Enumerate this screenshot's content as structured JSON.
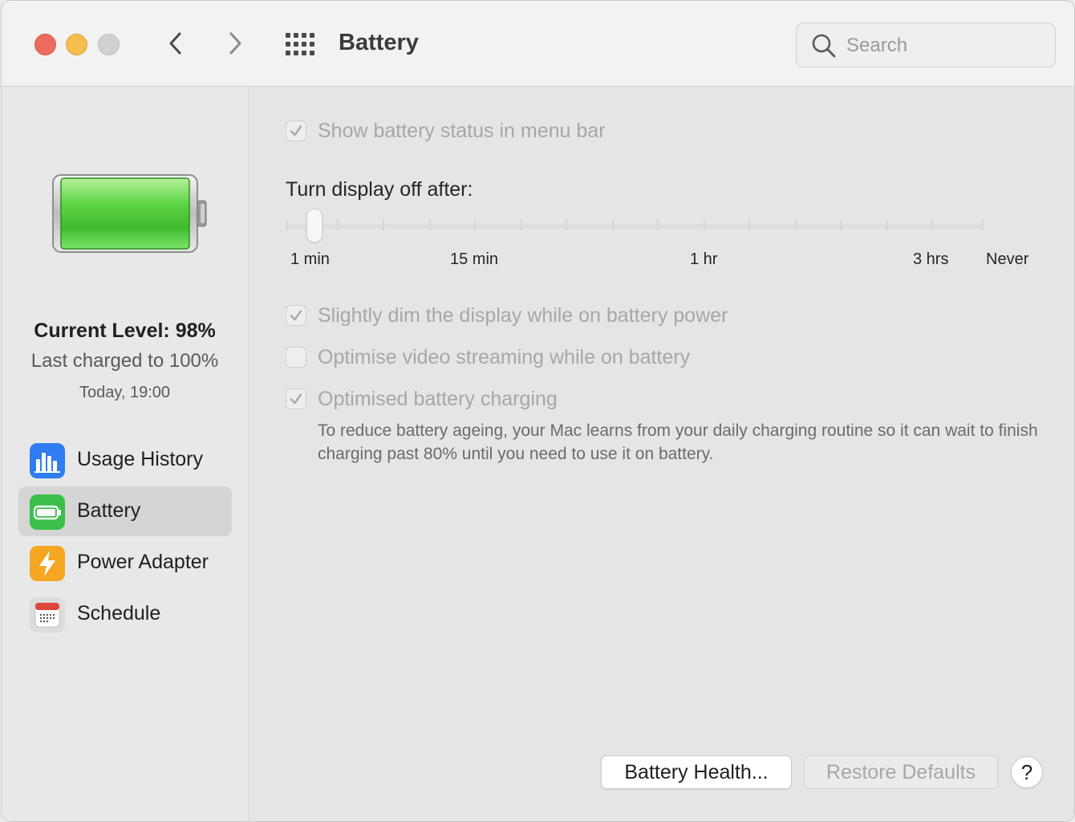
{
  "window": {
    "title": "Battery"
  },
  "toolbar": {
    "search_placeholder": "Search"
  },
  "sidebar": {
    "current_level": "Current Level: 98%",
    "last_charged": "Last charged to 100%",
    "last_charged_time": "Today, 19:00",
    "battery_level": 0.98,
    "items": [
      {
        "label": "Usage History",
        "icon": "usage-history-icon",
        "selected": false
      },
      {
        "label": "Battery",
        "icon": "battery-icon",
        "selected": true
      },
      {
        "label": "Power Adapter",
        "icon": "power-adapter-icon",
        "selected": false
      },
      {
        "label": "Schedule",
        "icon": "schedule-icon",
        "selected": false
      }
    ]
  },
  "main": {
    "show_status": {
      "label": "Show battery status in menu bar",
      "checked": true
    },
    "display_off": {
      "label": "Turn display off after:",
      "ticks": [
        "1 min",
        "15 min",
        "1 hr",
        "3 hrs",
        "Never"
      ],
      "value": "2 min"
    },
    "options": [
      {
        "label": "Slightly dim the display while on battery power",
        "checked": true
      },
      {
        "label": "Optimise video streaming while on battery",
        "checked": false
      },
      {
        "label": "Optimised battery charging",
        "checked": true
      }
    ],
    "optimised_description": "To reduce battery ageing, your Mac learns from your daily charging routine so it can wait to finish charging past 80% until you need to use it on battery."
  },
  "buttons": {
    "battery_health": "Battery Health...",
    "restore_defaults": "Restore Defaults",
    "help": "?"
  },
  "colors": {
    "battery_green": "#4cd13a",
    "selection": "#d5d5d5",
    "disabled_text": "#a7a7a7"
  }
}
